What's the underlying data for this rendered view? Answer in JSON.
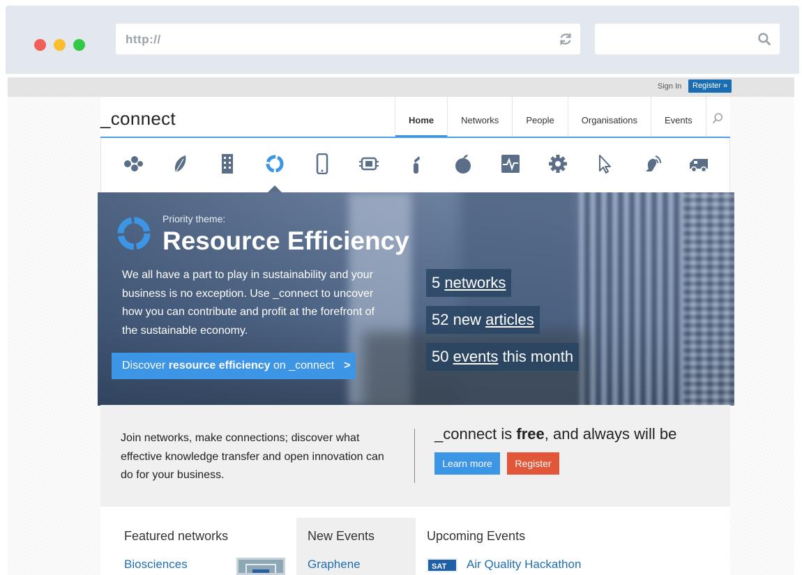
{
  "browser": {
    "url": "http://",
    "search_value": ""
  },
  "topbar": {
    "signin": "Sign In",
    "register": "Register »"
  },
  "site": {
    "logo": "_connect",
    "nav": [
      "Home",
      "Networks",
      "People",
      "Organisations",
      "Events"
    ],
    "active_nav": "Home"
  },
  "theme_icons": [
    "molecule-icon",
    "leaf-icon",
    "building-icon",
    "recycle-icon",
    "phone-icon",
    "chip-icon",
    "test-tube-icon",
    "apple-icon",
    "pulse-icon",
    "gear-icon",
    "cursor-icon",
    "hearing-icon",
    "truck-icon"
  ],
  "hero": {
    "kicker": "Priority theme:",
    "title": "Resource Efficiency",
    "description": "We all have a part to play in sustainability and your business is no exception. Use _connect to uncover how you can contribute and profit at the forefront of the sustainable economy.",
    "cta_prefix": "Discover ",
    "cta_bold": "resource efficiency",
    "cta_suffix": " on _connect",
    "cta_arrow": ">",
    "stats": [
      {
        "number": "5",
        "link": "networks",
        "suffix": ""
      },
      {
        "number": "52 new",
        "link": "articles",
        "suffix": ""
      },
      {
        "number": "50",
        "link": "events",
        "suffix": "this month"
      }
    ]
  },
  "intro": {
    "text": "Join networks, make connections; discover what effective knowledge transfer and open innovation can do for your business.",
    "headline_pre": "_connect is ",
    "headline_bold": "free",
    "headline_post": ", and always will be",
    "learn_more": "Learn more",
    "register": "Register"
  },
  "lower": {
    "featured_title": "Featured networks",
    "featured_link": "Biosciences",
    "new_events_title": "New Events",
    "new_events_link": "Graphene",
    "upcoming_title": "Upcoming Events",
    "upcoming_badge": "SAT",
    "upcoming_link": "Air Quality Hackathon"
  },
  "colors": {
    "accent": "#3d95e6",
    "register": "#e0573a",
    "link": "#1f6fb0",
    "icon": "#5a6f87"
  }
}
